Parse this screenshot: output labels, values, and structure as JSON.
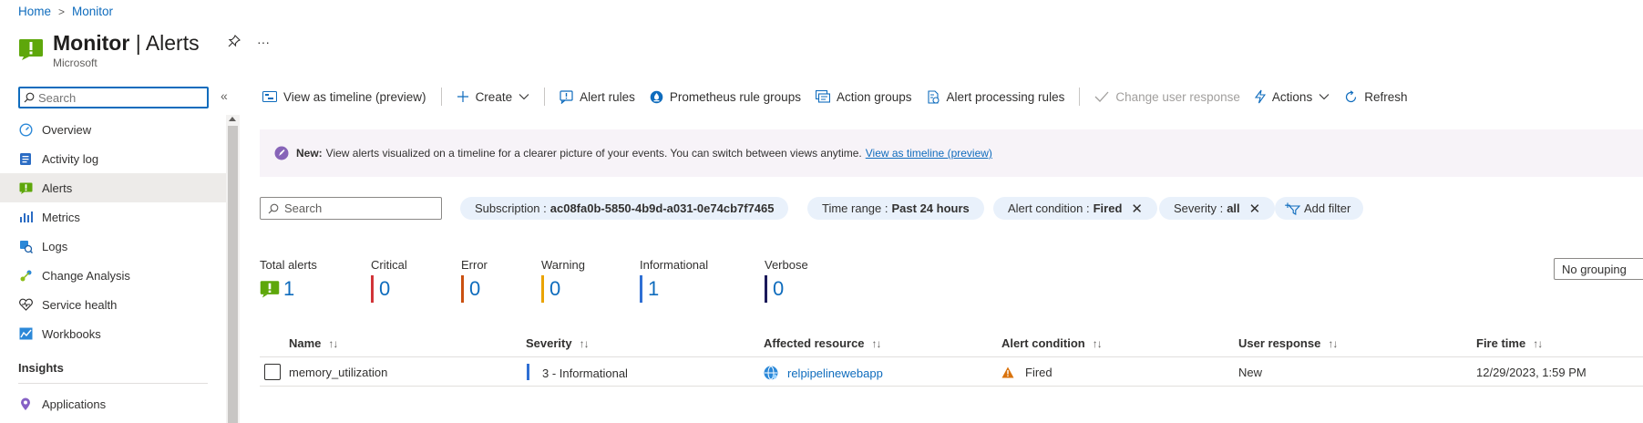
{
  "breadcrumb": {
    "home": "Home",
    "current": "Monitor"
  },
  "header": {
    "title_main": "Monitor",
    "title_sep": " | ",
    "title_page": "Alerts",
    "subtitle": "Microsoft",
    "pin_icon": "pin-icon",
    "more_label": "···"
  },
  "sidebar": {
    "search_placeholder": "Search",
    "collapse_label": "«",
    "items": [
      {
        "label": "Overview",
        "icon": "overview-icon"
      },
      {
        "label": "Activity log",
        "icon": "activity-log-icon"
      },
      {
        "label": "Alerts",
        "icon": "alerts-icon",
        "active": true
      },
      {
        "label": "Metrics",
        "icon": "metrics-icon"
      },
      {
        "label": "Logs",
        "icon": "logs-icon"
      },
      {
        "label": "Change Analysis",
        "icon": "change-analysis-icon"
      },
      {
        "label": "Service health",
        "icon": "service-health-icon"
      },
      {
        "label": "Workbooks",
        "icon": "workbooks-icon"
      }
    ],
    "section_insights": "Insights",
    "insights_items": [
      {
        "label": "Applications",
        "icon": "applications-icon"
      }
    ]
  },
  "toolbar": {
    "timeline": "View as timeline (preview)",
    "create": "Create",
    "alert_rules": "Alert rules",
    "prometheus": "Prometheus rule groups",
    "action_groups": "Action groups",
    "processing_rules": "Alert processing rules",
    "change_response": "Change user response",
    "actions": "Actions",
    "refresh": "Refresh"
  },
  "banner": {
    "new_label": "New:",
    "text": "View alerts visualized on a timeline for a clearer picture of your events. You can switch between views anytime.",
    "link": "View as timeline (preview)"
  },
  "filters": {
    "search_placeholder": "Search",
    "subscription_label": "Subscription :",
    "subscription_value": "ac08fa0b-5850-4b9d-a031-0e74cb7f7465",
    "time_label": "Time range :",
    "time_value": "Past 24 hours",
    "condition_label": "Alert condition :",
    "condition_value": "Fired",
    "severity_label": "Severity :",
    "severity_value": "all",
    "add_filter": "Add filter"
  },
  "summary": {
    "total": {
      "label": "Total alerts",
      "value": "1"
    },
    "critical": {
      "label": "Critical",
      "value": "0",
      "color": "#d13438"
    },
    "error": {
      "label": "Error",
      "value": "0",
      "color": "#ca5010"
    },
    "warning": {
      "label": "Warning",
      "value": "0",
      "color": "#eaa300"
    },
    "informational": {
      "label": "Informational",
      "value": "1",
      "color": "#2f6fd4"
    },
    "verbose": {
      "label": "Verbose",
      "value": "0",
      "color": "#1b1a5a"
    }
  },
  "grouping": {
    "value": "No grouping"
  },
  "table": {
    "columns": [
      "Name",
      "Severity",
      "Affected resource",
      "Alert condition",
      "User response",
      "Fire time"
    ],
    "rows": [
      {
        "name": "memory_utilization",
        "severity": "3 - Informational",
        "resource": "relpipelinewebapp",
        "condition": "Fired",
        "response": "New",
        "fire_time": "12/29/2023, 1:59 PM"
      }
    ]
  }
}
